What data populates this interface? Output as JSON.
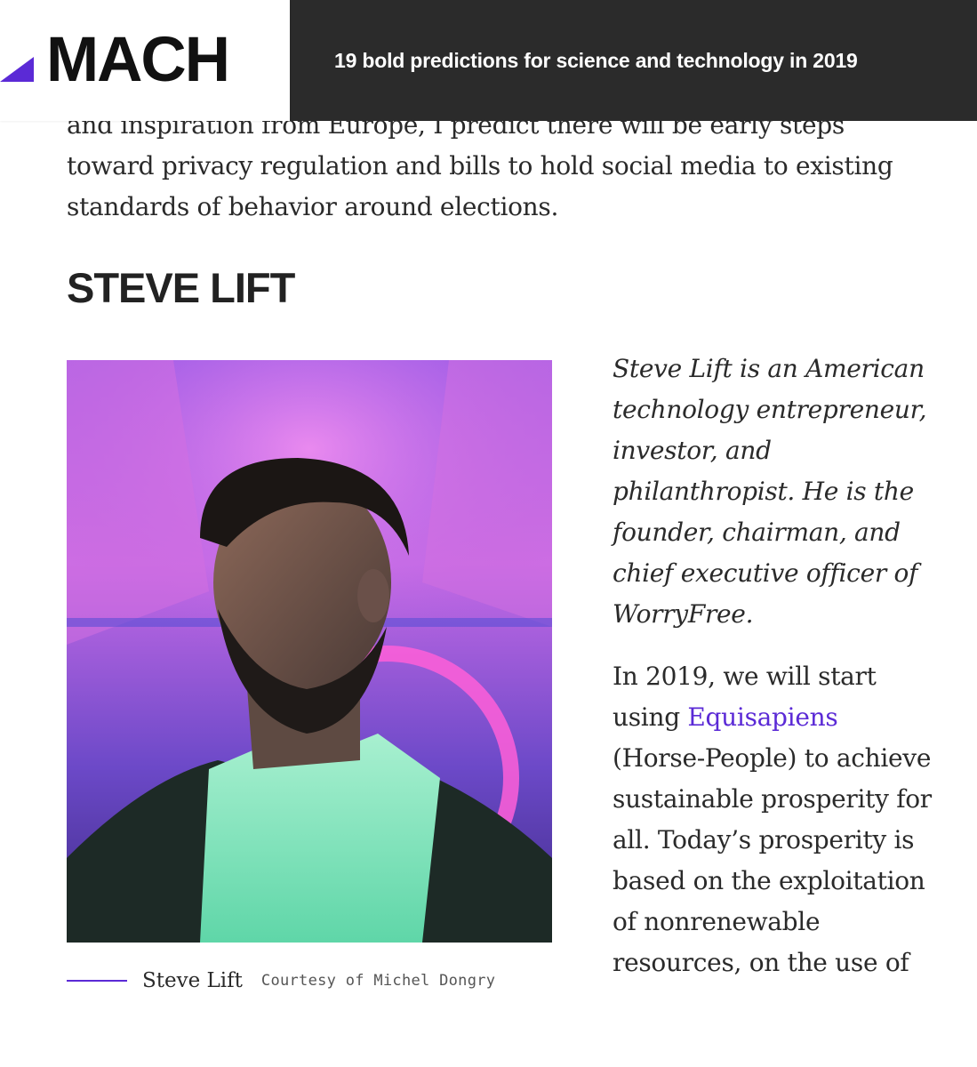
{
  "header": {
    "logo": "MACH",
    "headline": "19 bold predictions for science and technology in 2019"
  },
  "article": {
    "intro_partial": "and inspiration from Europe, I predict there will be early steps toward privacy regulation and bills to hold social media to existing standards of behavior around elections.",
    "section_heading": "STEVE LIFT",
    "photo": {
      "caption_name": "Steve Lift",
      "caption_credit": "Courtesy of Michel Dongry"
    },
    "bio": "Steve Lift is an American technology entrepreneur, investor, and philanthropist. He is the founder, chairman, and chief executive officer of WorryFree.",
    "body": {
      "before_link": "In 2019, we will start using ",
      "link_text": "Equisapiens",
      "after_link": " (Horse-People) to achieve sustainable prosperity for all. Today’s prosperity is based on the exploitation of nonrenewable resources, on the use of"
    }
  },
  "colors": {
    "accent": "#5b2ad6",
    "header_bar": "#2b2b2b",
    "text": "#2a2a2a"
  }
}
